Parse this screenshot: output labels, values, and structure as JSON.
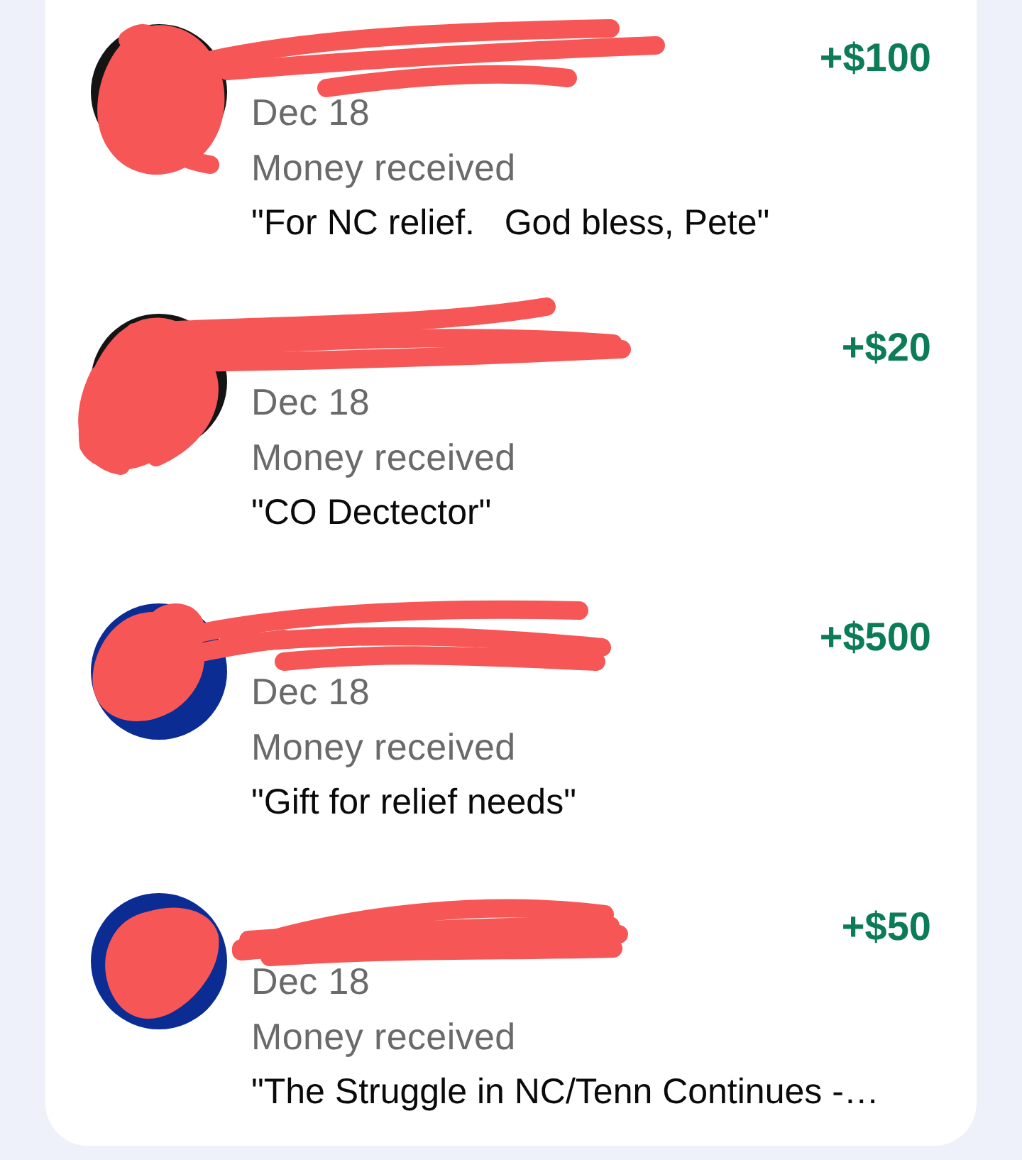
{
  "transactions": [
    {
      "avatar": {
        "color": "#141414"
      },
      "name_redacted": true,
      "amount": "+$100",
      "date": "Dec 18",
      "status": "Money received",
      "memo": "\"For NC relief.   God bless, Pete\""
    },
    {
      "avatar": {
        "color": "#141414"
      },
      "name_redacted": true,
      "amount": "+$20",
      "date": "Dec 18",
      "status": "Money received",
      "memo": "\"CO Dectector\""
    },
    {
      "avatar": {
        "color": "#0b2c93"
      },
      "name_redacted": true,
      "amount": "+$500",
      "date": "Dec 18",
      "status": "Money received",
      "memo": "\"Gift for relief needs\""
    },
    {
      "avatar": {
        "color": "#0b2c93"
      },
      "name_redacted": true,
      "amount": "+$50",
      "date": "Dec 18",
      "status": "Money received",
      "memo": "\"The Struggle in NC/Tenn Continues -…"
    }
  ]
}
